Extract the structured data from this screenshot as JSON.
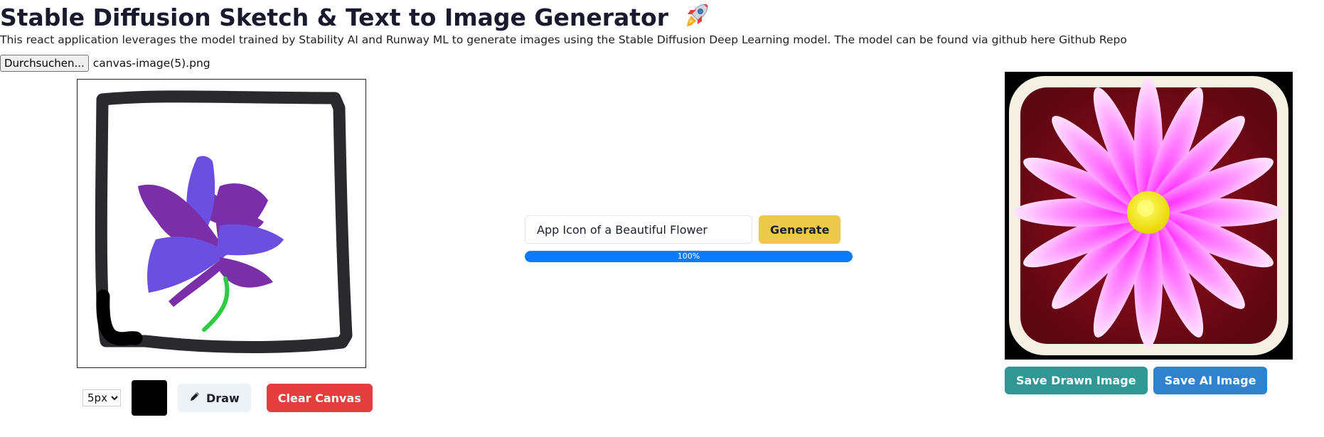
{
  "header": {
    "title": "Stable Diffusion Sketch & Text to Image Generator",
    "title_icon": "rocket-icon",
    "subtitle": "This react application leverages the model trained by Stability AI and Runway ML to generate images using the Stable Diffusion Deep Learning model. The model can be found via github here Github Repo"
  },
  "file_input": {
    "button_label": "Durchsuchen...",
    "file_name": "canvas-image(5).png"
  },
  "canvas_tools": {
    "brush_size": "5px",
    "brush_size_options": [
      "5px"
    ],
    "color_value": "#000000",
    "draw_label": "Draw",
    "draw_icon": "pencil-icon",
    "clear_label": "Clear Canvas"
  },
  "prompt": {
    "value": "App Icon of a Beautiful Flower",
    "generate_label": "Generate"
  },
  "progress": {
    "value_percent": 100,
    "label": "100%"
  },
  "actions": {
    "save_drawn_label": "Save Drawn Image",
    "save_ai_label": "Save AI Image"
  },
  "colors": {
    "generate": "#ecc94b",
    "clear": "#e53e3e",
    "save_drawn": "#319795",
    "save_ai": "#3182ce",
    "progress": "#0a7bff"
  }
}
